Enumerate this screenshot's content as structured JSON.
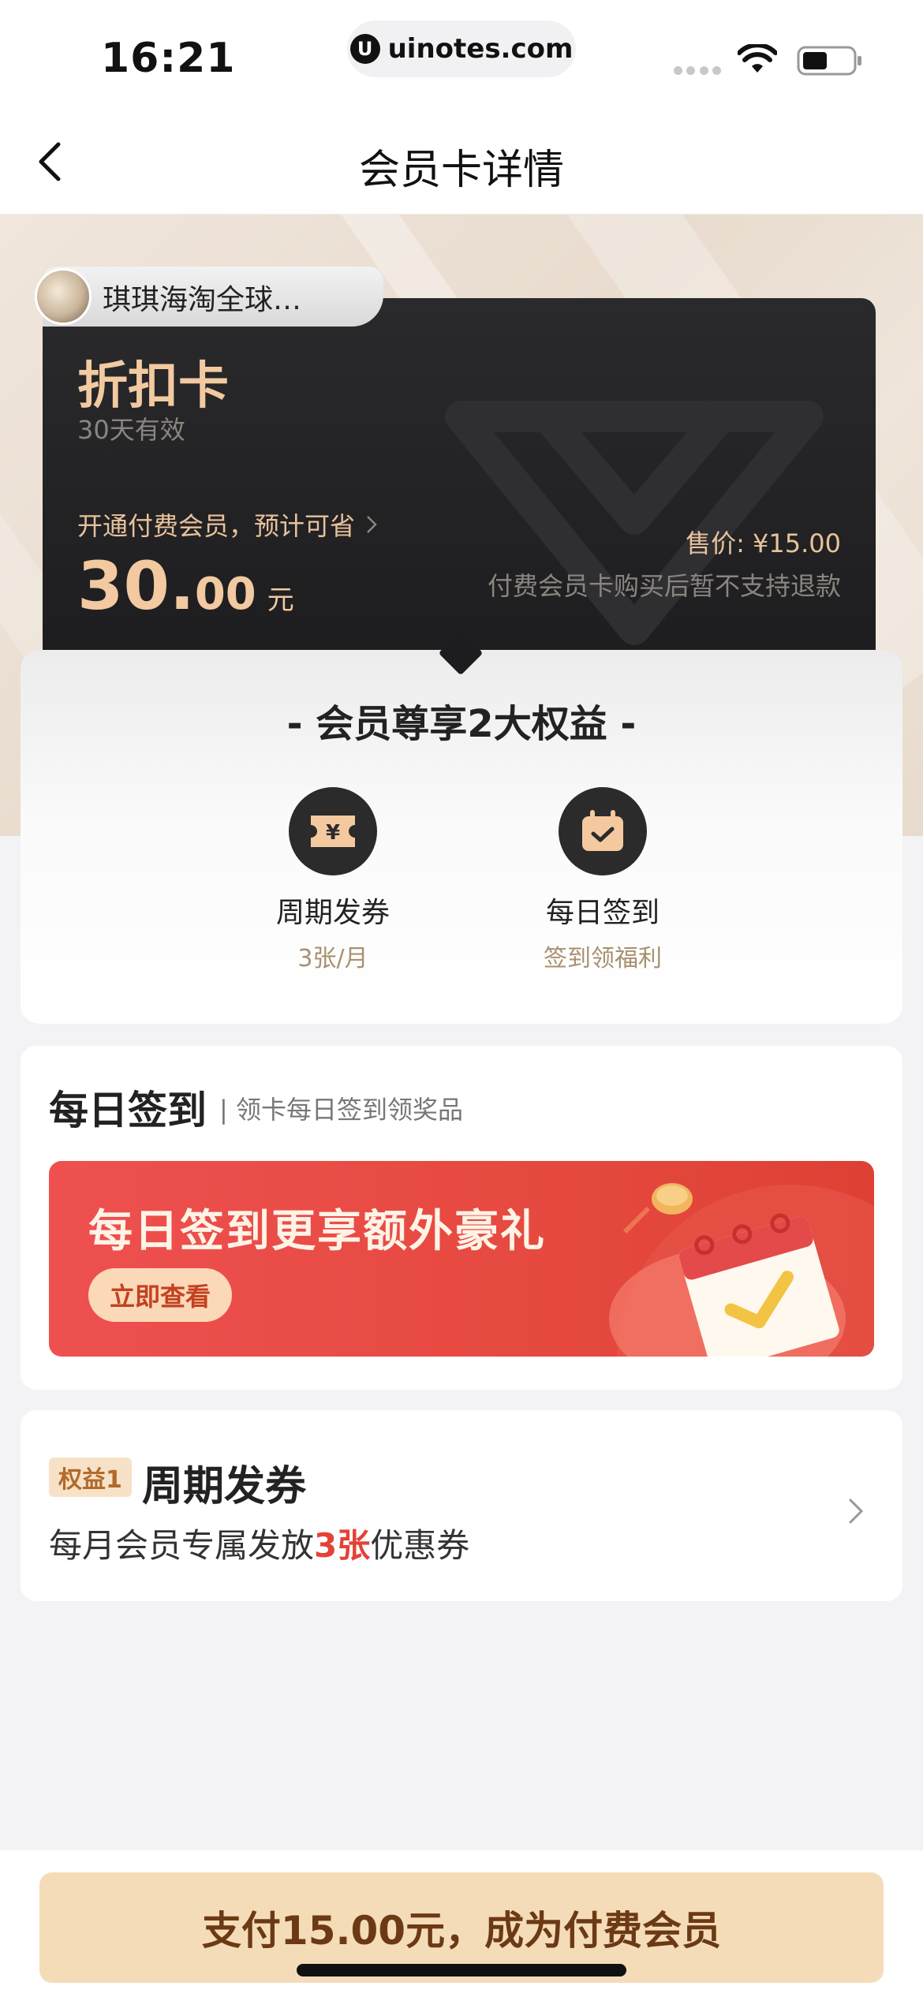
{
  "status_bar": {
    "time": "16:21",
    "url": "uinotes.com",
    "url_logo_letter": "U"
  },
  "nav": {
    "title": "会员卡详情",
    "back_icon": "chevron-left-icon"
  },
  "card": {
    "shop_name": "琪琪海淘全球…",
    "title": "折扣卡",
    "validity": "30天有效",
    "save_text": "开通付费会员，预计可省",
    "amount_int": "30.",
    "amount_dec": "00",
    "amount_unit": "元",
    "price": "售价: ¥15.00",
    "refund_note": "付费会员卡购买后暂不支持退款"
  },
  "benefits": {
    "title": "- 会员尊享2大权益 -",
    "items": [
      {
        "name": "周期发券",
        "desc": "3张/月",
        "icon": "coupon-icon"
      },
      {
        "name": "每日签到",
        "desc": "签到领福利",
        "icon": "calendar-check-icon"
      }
    ]
  },
  "daily_sign": {
    "title": "每日签到",
    "subtitle": "| 领卡每日签到领奖品",
    "banner_text": "每日签到更享额外豪礼",
    "banner_button": "立即查看"
  },
  "benefit_1": {
    "tag": "权益1",
    "title": "周期发券",
    "desc_prefix": "每月会员专属发放",
    "desc_highlight": "3张",
    "desc_suffix": "优惠券"
  },
  "pay_button": "支付15.00元，成为付费会员",
  "colors": {
    "accent_gold": "#f2c9a0",
    "card_dark": "#1d1d1f",
    "banner_red": "#e6493f",
    "pay_button_bg": "#f5dcb9",
    "highlight_red": "#e44236"
  }
}
